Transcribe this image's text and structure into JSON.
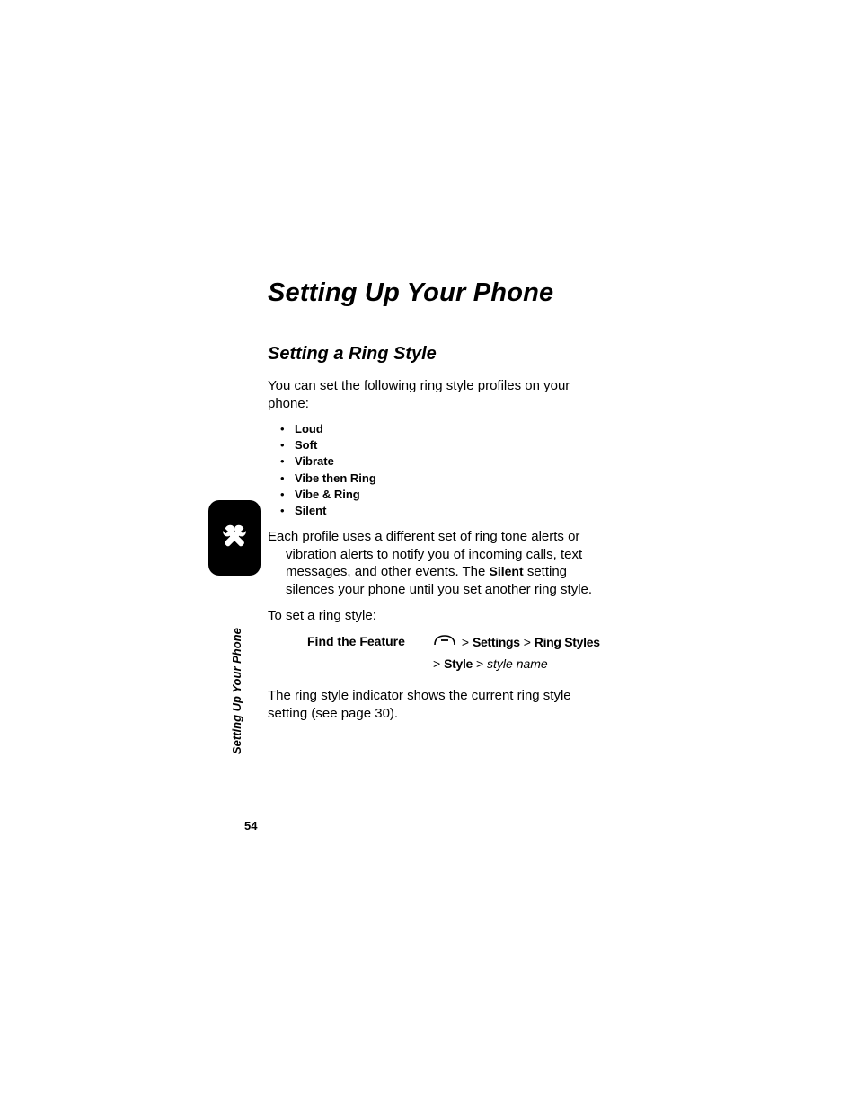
{
  "chapter_title": "Setting Up Your Phone",
  "section_title": "Setting a Ring Style",
  "intro_text": "You can set the following ring style profiles on your phone:",
  "profiles": {
    "0": "Loud",
    "1": "Soft",
    "2": "Vibrate",
    "3": "Vibe then Ring",
    "4": "Vibe & Ring",
    "5": "Silent"
  },
  "desc": {
    "part1": "Each profile uses a different set of ring tone alerts or",
    "part2": "vibration alerts to notify you of incoming calls, text messages, and other events. The ",
    "silent_word": "Silent",
    "part3": " setting silences your phone until you set another ring style."
  },
  "to_set": "To set a ring style:",
  "feature": {
    "label": "Find the Feature",
    "path1_sep1": ">",
    "path1_settings": "Settings",
    "path1_sep2": ">",
    "path1_ringstyles": "Ring Styles",
    "path2_sep1": ">",
    "path2_style": "Style",
    "path2_sep2": ">",
    "path2_stylename": "style name"
  },
  "closing_text": "The ring style indicator shows the current ring style setting (see page 30).",
  "side_tab": "Setting Up Your Phone",
  "page_number": "54"
}
